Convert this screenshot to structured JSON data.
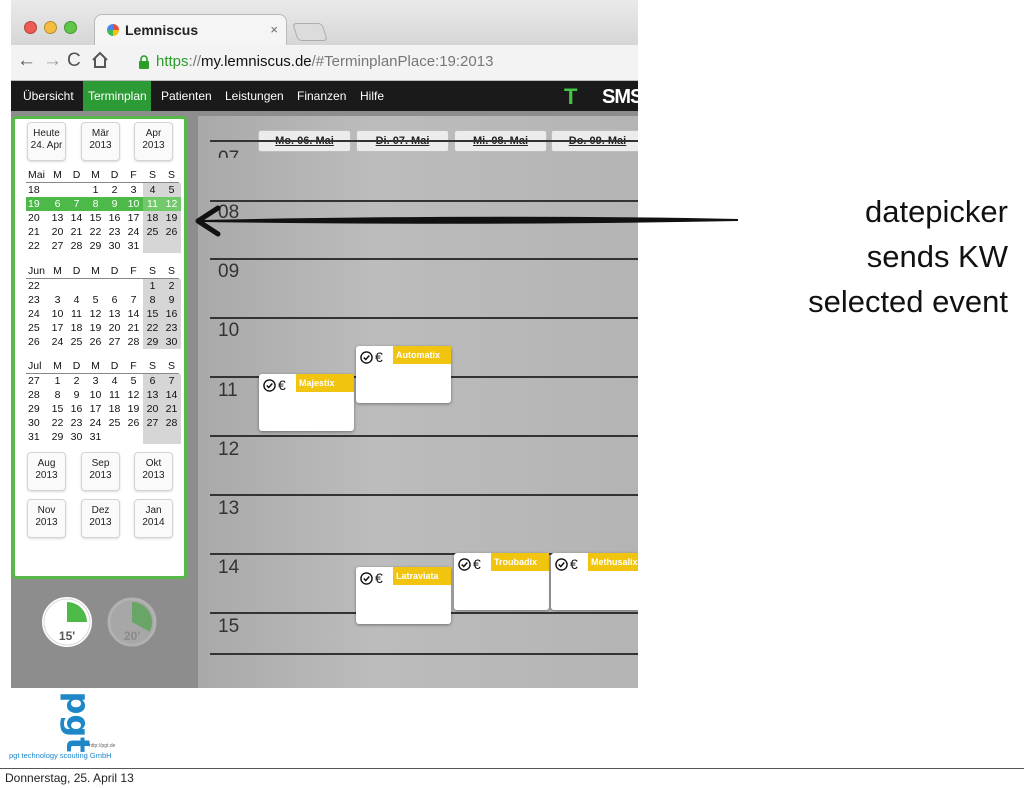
{
  "browser": {
    "tab_title": "Lemniscus",
    "tab_close": "×",
    "url_scheme": "https",
    "url_sep": "://",
    "url_host": "my.lemniscus.de",
    "url_path": "/#TerminplanPlace:19:2013",
    "back": "←",
    "forward": "→",
    "reload": "C"
  },
  "menu": {
    "items": [
      {
        "label": "Übersicht"
      },
      {
        "label": "Terminplan"
      },
      {
        "label": "Patienten"
      },
      {
        "label": "Leistungen"
      },
      {
        "label": "Finanzen"
      },
      {
        "label": "Hilfe"
      }
    ],
    "active_index": 1,
    "logo_t": "T",
    "logo_sms": "SMS"
  },
  "datepicker": {
    "top_buttons": [
      {
        "line1": "Heute",
        "line2": "24. Apr"
      },
      {
        "line1": "Mär",
        "line2": "2013"
      },
      {
        "line1": "Apr",
        "line2": "2013"
      }
    ],
    "months": [
      {
        "name": "Mai",
        "headers": [
          "M",
          "D",
          "M",
          "D",
          "F",
          "S",
          "S"
        ],
        "weeks": [
          {
            "kw": "18",
            "days": [
              "",
              "",
              "1",
              "2",
              "3",
              "4",
              "5"
            ]
          },
          {
            "kw": "19",
            "days": [
              "6",
              "7",
              "8",
              "9",
              "10",
              "11",
              "12"
            ],
            "selected": true
          },
          {
            "kw": "20",
            "days": [
              "13",
              "14",
              "15",
              "16",
              "17",
              "18",
              "19"
            ]
          },
          {
            "kw": "21",
            "days": [
              "20",
              "21",
              "22",
              "23",
              "24",
              "25",
              "26"
            ]
          },
          {
            "kw": "22",
            "days": [
              "27",
              "28",
              "29",
              "30",
              "31",
              "",
              ""
            ]
          }
        ]
      },
      {
        "name": "Jun",
        "headers": [
          "M",
          "D",
          "M",
          "D",
          "F",
          "S",
          "S"
        ],
        "weeks": [
          {
            "kw": "22",
            "days": [
              "",
              "",
              "",
              "",
              "",
              "1",
              "2"
            ]
          },
          {
            "kw": "23",
            "days": [
              "3",
              "4",
              "5",
              "6",
              "7",
              "8",
              "9"
            ]
          },
          {
            "kw": "24",
            "days": [
              "10",
              "11",
              "12",
              "13",
              "14",
              "15",
              "16"
            ]
          },
          {
            "kw": "25",
            "days": [
              "17",
              "18",
              "19",
              "20",
              "21",
              "22",
              "23"
            ]
          },
          {
            "kw": "26",
            "days": [
              "24",
              "25",
              "26",
              "27",
              "28",
              "29",
              "30"
            ]
          }
        ]
      },
      {
        "name": "Jul",
        "headers": [
          "M",
          "D",
          "M",
          "D",
          "F",
          "S",
          "S"
        ],
        "weeks": [
          {
            "kw": "27",
            "days": [
              "1",
              "2",
              "3",
              "4",
              "5",
              "6",
              "7"
            ]
          },
          {
            "kw": "28",
            "days": [
              "8",
              "9",
              "10",
              "11",
              "12",
              "13",
              "14"
            ]
          },
          {
            "kw": "29",
            "days": [
              "15",
              "16",
              "17",
              "18",
              "19",
              "20",
              "21"
            ]
          },
          {
            "kw": "30",
            "days": [
              "22",
              "23",
              "24",
              "25",
              "26",
              "27",
              "28"
            ]
          },
          {
            "kw": "31",
            "days": [
              "29",
              "30",
              "31",
              "",
              "",
              "",
              ""
            ]
          }
        ]
      }
    ],
    "bottom_buttons": [
      {
        "line1": "Aug",
        "line2": "2013"
      },
      {
        "line1": "Sep",
        "line2": "2013"
      },
      {
        "line1": "Okt",
        "line2": "2013"
      },
      {
        "line1": "Nov",
        "line2": "2013"
      },
      {
        "line1": "Dez",
        "line2": "2013"
      },
      {
        "line1": "Jan",
        "line2": "2014"
      }
    ],
    "timers": [
      {
        "label": "15'",
        "fraction": 0.25
      },
      {
        "label": "20'",
        "fraction": 0.33
      }
    ]
  },
  "calendar": {
    "days": [
      "Mo. 06. Mai",
      "Di. 07. Mai",
      "Mi. 08. Mai",
      "Do. 09. Mai"
    ],
    "hours": [
      "07",
      "08",
      "09",
      "10",
      "11",
      "12",
      "13",
      "14",
      "15"
    ],
    "events": [
      {
        "title": "Majestix",
        "currency": "€"
      },
      {
        "title": "Automatix",
        "currency": "€"
      },
      {
        "title": "Latraviata",
        "currency": "€"
      },
      {
        "title": "Troubadix",
        "currency": "€"
      },
      {
        "title": "Methusalix",
        "currency": "€"
      }
    ]
  },
  "annotation": {
    "line1": "datepicker",
    "line2": "sends KW",
    "line3": "selected event"
  },
  "footer": {
    "date": "Donnerstag, 25. April 13",
    "logo_text": "pgt",
    "logo_company": "pgt technology scouting GmbH",
    "logo_url": "http://pgt.de"
  },
  "colors": {
    "accent_green": "#4cb948",
    "menu_bg": "#1a1a1a",
    "event_yellow": "#f1c40f"
  }
}
